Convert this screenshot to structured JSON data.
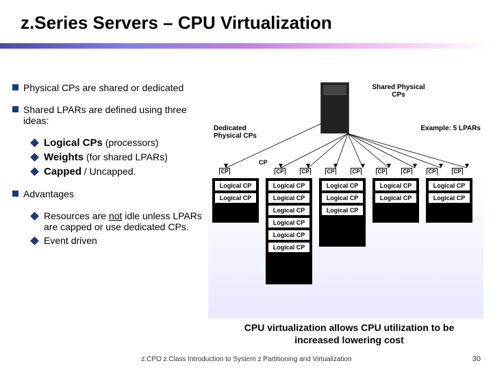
{
  "title": "z.Series Servers – CPU Virtualization",
  "bullets": {
    "b1a": "Physical CPs are shared or dedicated",
    "b1b": "Shared LPARs are defined using three ideas:",
    "b2a_pre": "Logical CPs",
    "b2a_post": " (processors)",
    "b2b_pre": "Weights",
    "b2b_post": " (for shared LPARs)",
    "b2c_pre": "Capped",
    "b2c_post": " / Uncapped.",
    "b1c": "Advantages",
    "b2d_pre": "Resources are ",
    "b2d_not": "not",
    "b2d_post": " idle unless LPARs are capped or use dedicated CPs.",
    "b2e": "Event driven"
  },
  "labels": {
    "shared_physical": "Shared Physical CPs",
    "dedicated_physical": "Dedicated Physical CPs",
    "example": "Example: 5 LPARs",
    "cp": "CP",
    "logical_cp": "Logical CP"
  },
  "caption": "CPU virtualization allows CPU utilization to be increased lowering cost",
  "footer": "z.CPO z.Class  Introduction to System z Partitioning and Virtualization",
  "page": "30"
}
